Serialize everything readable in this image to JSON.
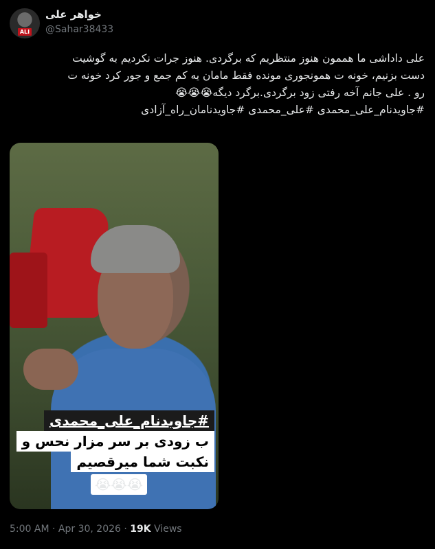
{
  "author": {
    "display_name": "خواهر علی",
    "handle": "@Sahar38433",
    "avatar_badge": "ALI"
  },
  "tweet": {
    "lines": [
      "علی داداشی ما هممون هنوز منتظریم که برگردی. هنوز جرات نکردیم به گوشیت",
      "دست بزنیم، خونه ت همونجوری مونده فقط مامان یه کم جمع و جور کرد خونه ت",
      "رو . علی جانم آخه رفتی زود برگردی.برگرد دیگه😭😭😭",
      "#جاویدنام_علی_محمدی #علی_محمدی #جاویدنامان_راه_آزادی"
    ]
  },
  "media": {
    "caption_line_1": "#جاویدنام_علی_محمدی",
    "caption_line_2": "ب زودی بر سر مزار نحس و",
    "caption_line_3": "نکبت شما میرقصیم",
    "caption_emoji": "😭😭😭"
  },
  "meta": {
    "time": "5:00 AM",
    "separator": "·",
    "date": "Apr 30, 2026",
    "views_count": "19K",
    "views_label": "Views"
  },
  "colors": {
    "background": "#000000",
    "text": "#e7e9ea",
    "secondary": "#71767b"
  }
}
